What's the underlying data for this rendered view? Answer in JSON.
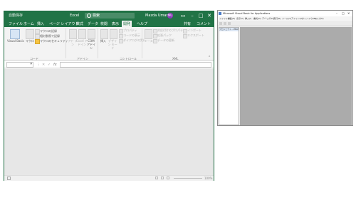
{
  "excel": {
    "title": {
      "autosave": "自動保存",
      "filename": "Excel",
      "search_placeholder": "検索",
      "user": "Mazda Umar",
      "avatar_initials": "MU"
    },
    "tabs": [
      "ファイル",
      "ホーム",
      "挿入",
      "ページ レイアウト",
      "数式",
      "データ",
      "校閲",
      "表示",
      "開発",
      "ヘルプ"
    ],
    "active_tab": "開発",
    "share_label": "共有",
    "comment_label": "コメント",
    "ribbon": {
      "code": {
        "visual_basic": "Visual Basic",
        "macro": "マクロ",
        "record_macro": "マクロの記録",
        "relative_ref": "相対参照で記録",
        "macro_security": "マクロのセキュリティ",
        "group": "コード"
      },
      "addins": {
        "addins": "アド イン",
        "excel_addins": "Excel アドイン",
        "com_addins": "COM アドイン",
        "group": "アドイン"
      },
      "controls": {
        "insert": "挿入",
        "design_mode": "デザイン モード",
        "properties": "プロパティ",
        "view_code": "コードの表示",
        "run_dialog": "ダイアログの実行",
        "group": "コントロール"
      },
      "xml": {
        "source": "ソース",
        "map_properties": "対応付けのプロパティ",
        "expansion_packs": "拡張パック",
        "refresh_data": "データの更新",
        "import": "インポート",
        "export": "エクスポート",
        "group": "XML"
      }
    },
    "status": {
      "zoom": "100%"
    }
  },
  "vba": {
    "title": "Microsoft Visual Basic for Applications",
    "menu": [
      "ファイル(F)",
      "編集(E)",
      "表示(V)",
      "挿入(I)",
      "書式(O)",
      "デバッグ(D)",
      "実行(R)",
      "ツール(T)",
      "アドイン(A)",
      "ウィンドウ(W)",
      "ヘルプ(H)"
    ],
    "project_header": "プロジェクト - VBAProject"
  }
}
